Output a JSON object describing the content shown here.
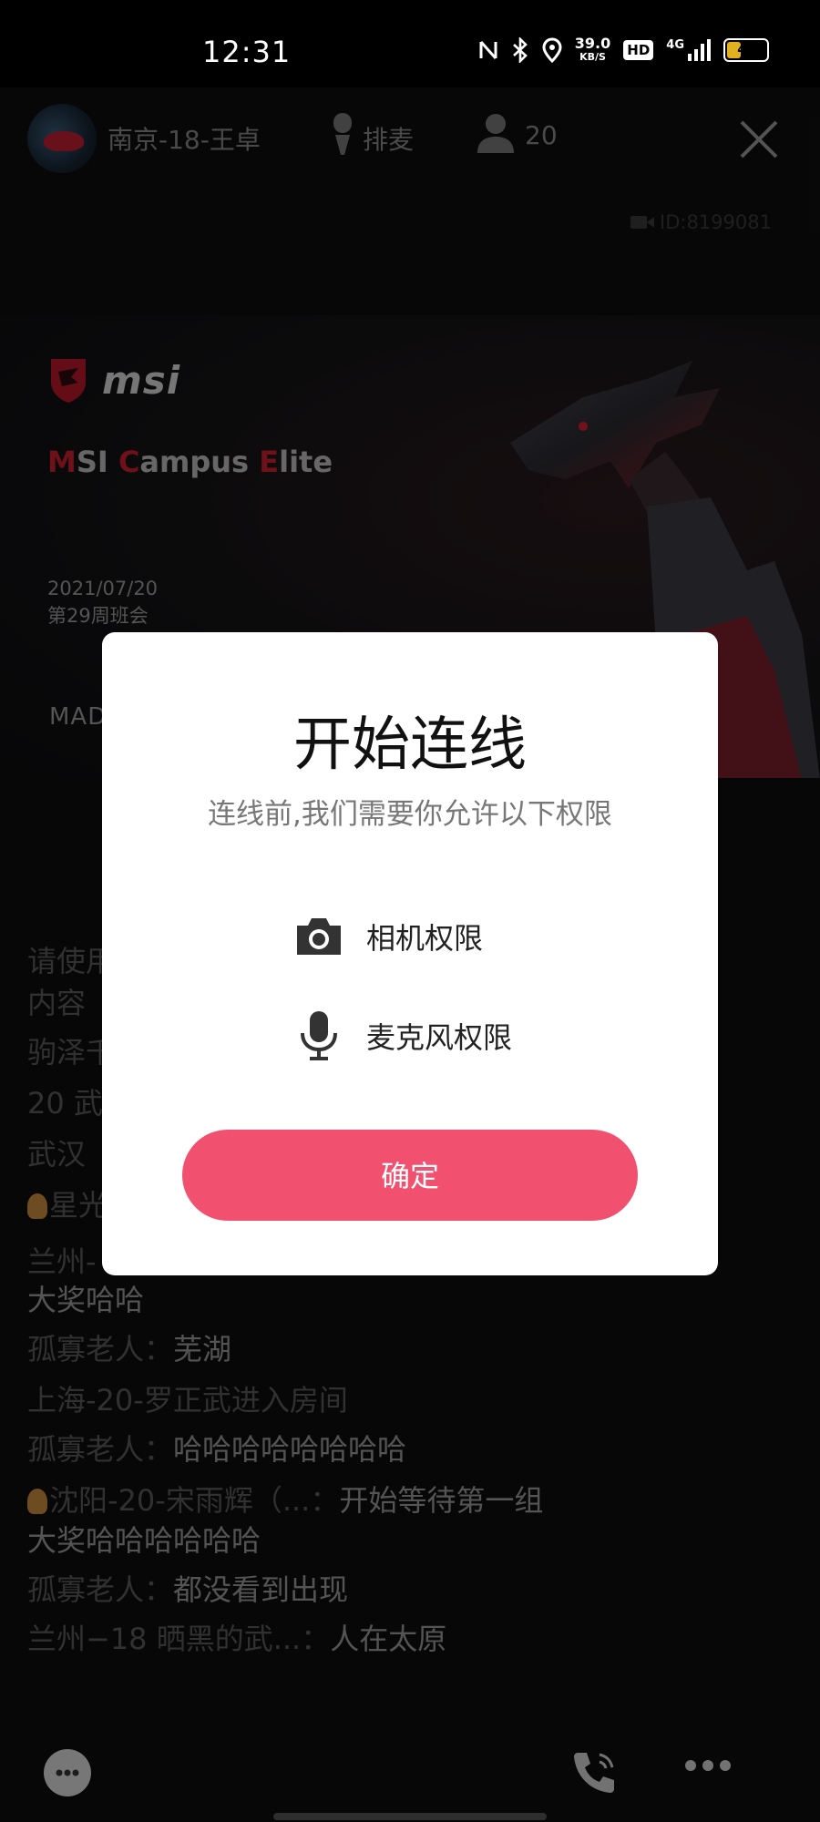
{
  "status_bar": {
    "time": "12:31",
    "net_speed_value": "39.0",
    "net_speed_unit": "KB/S",
    "hd_label": "HD",
    "signal_label": "4G",
    "battery_level": "40",
    "battery_fraction": 0.4
  },
  "room": {
    "host_name": "南京-18-王卓",
    "queue_label": "排麦",
    "viewer_count": "20",
    "room_id": "ID:8199081"
  },
  "banner": {
    "brand_word": "msi",
    "campus_parts": [
      "M",
      "SI ",
      "C",
      "ampus ",
      "E",
      "lite"
    ],
    "date": "2021/07/20",
    "meeting": "第29周班会",
    "made_text": "MADE"
  },
  "chat": {
    "lines": [
      {
        "text": "请使用"
      },
      {
        "text": "内容"
      },
      {
        "text": "驹泽千"
      },
      {
        "text": "20 武"
      },
      {
        "text": "武汉"
      },
      {
        "text": "星光"
      },
      {
        "text": "兰州-"
      },
      {
        "text": "大奖哈哈"
      },
      {
        "user": "孤寡老人：",
        "msg": "芜湖"
      },
      {
        "text": "上海-20-罗正武进入房间"
      },
      {
        "user": "孤寡老人：",
        "msg": "哈哈哈哈哈哈哈哈"
      },
      {
        "user": "沈阳-20-宋雨辉（...：",
        "msg": "开始等待第一组"
      },
      {
        "text": "大奖哈哈哈哈哈哈"
      },
      {
        "user": "孤寡老人：",
        "msg": "都没看到出现"
      },
      {
        "user": "兰州−18 晒黑的武...：",
        "msg": "人在太原"
      }
    ]
  },
  "dialog": {
    "title": "开始连线",
    "subtitle": "连线前,我们需要你允许以下权限",
    "permissions": [
      {
        "label": "相机权限",
        "icon": "camera-icon"
      },
      {
        "label": "麦克风权限",
        "icon": "microphone-icon"
      }
    ],
    "confirm_label": "确定"
  },
  "colors": {
    "accent": "#f2506f",
    "brand_red": "#c8202c"
  }
}
